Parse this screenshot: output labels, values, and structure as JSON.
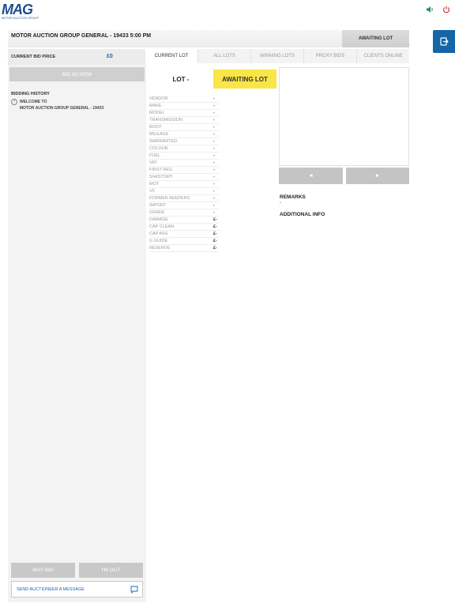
{
  "app": {
    "logo_text": "MAG",
    "logo_sub": "MOTOR AUCTION GROUP"
  },
  "header": {
    "title": "MOTOR AUCTION GROUP GENERAL - 19433 5:00 PM",
    "status": "AWAITING LOT"
  },
  "left_panel": {
    "bid_price_label": "CURRENT BID PRICE",
    "bid_price_value": "£0",
    "bid_now_label": "BID £0 NOW",
    "history_title": "BIDDING HISTORY",
    "history": [
      {
        "line1": "WELCOME TO",
        "line2": "MOTOR AUCTION GROUP GENERAL - 19433"
      }
    ],
    "may_bid_label": "MAY BID",
    "im_out_label": "I'M OUT",
    "message_label": "SEND AUCTIONEER A MESSAGE"
  },
  "tabs": [
    {
      "label": "CURRENT LOT",
      "active": true
    },
    {
      "label": "ALL LOTS",
      "active": false
    },
    {
      "label": "WINNING LOTS",
      "active": false
    },
    {
      "label": "PROXY BIDS",
      "active": false
    },
    {
      "label": "CLIENTS ONLINE",
      "active": false
    }
  ],
  "lot": {
    "label": "LOT -",
    "status": "AWAITING LOT"
  },
  "details": [
    {
      "key": "VENDOR",
      "value": "-"
    },
    {
      "key": "MAKE",
      "value": "-"
    },
    {
      "key": "MODEL",
      "value": "-"
    },
    {
      "key": "TRANSMISSION",
      "value": "-"
    },
    {
      "key": "BODY",
      "value": "-"
    },
    {
      "key": "MILEAGE",
      "value": "-"
    },
    {
      "key": "WARRANTED",
      "value": "-"
    },
    {
      "key": "COLOUR",
      "value": "-"
    },
    {
      "key": "FUEL",
      "value": "-"
    },
    {
      "key": "VAT",
      "value": "-"
    },
    {
      "key": "FIRST REG",
      "value": "-"
    },
    {
      "key": "S/HISTORY",
      "value": "-"
    },
    {
      "key": "MOT",
      "value": "-"
    },
    {
      "key": "V5",
      "value": "-"
    },
    {
      "key": "FORMER KEEPERS",
      "value": "-"
    },
    {
      "key": "IMPORT",
      "value": "-"
    },
    {
      "key": "GRADE",
      "value": "-"
    },
    {
      "key": "DAMAGE",
      "value": "£-"
    },
    {
      "key": "CAP CLEAN",
      "value": "£-"
    },
    {
      "key": "CAP AVG",
      "value": "£-"
    },
    {
      "key": "G GUIDE",
      "value": "£-"
    },
    {
      "key": "RESERVE",
      "value": "£-"
    }
  ],
  "gallery": {
    "prev_icon": "◄",
    "next_icon": "►"
  },
  "remarks": {
    "title": "REMARKS",
    "value": "-"
  },
  "additional_info": {
    "title": "ADDITIONAL INFO"
  },
  "colors": {
    "accent": "#1565a8",
    "price": "#1b64b4",
    "awaiting": "#f8e548"
  }
}
